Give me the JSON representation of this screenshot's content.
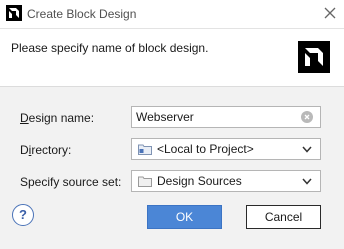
{
  "window": {
    "title": "Create Block Design",
    "icon": "xilinx-logo-icon"
  },
  "header": {
    "message": "Please specify name of block design.",
    "logo": "xilinx-logo-icon"
  },
  "form": {
    "design_name": {
      "label_mnemonic": "D",
      "label_rest": "esign name:",
      "value": "Webserver"
    },
    "directory": {
      "label_prefix": "D",
      "label_mnemonic": "i",
      "label_rest": "rectory:",
      "value": "<Local to Project>",
      "icon": "folder-icon"
    },
    "source_set": {
      "label": "Specify source set:",
      "value": "Design Sources",
      "icon": "folder-icon"
    }
  },
  "buttons": {
    "help": "?",
    "ok": "OK",
    "cancel": "Cancel"
  },
  "colors": {
    "primary_button": "#4b86d6",
    "help_icon": "#4a73b8"
  }
}
